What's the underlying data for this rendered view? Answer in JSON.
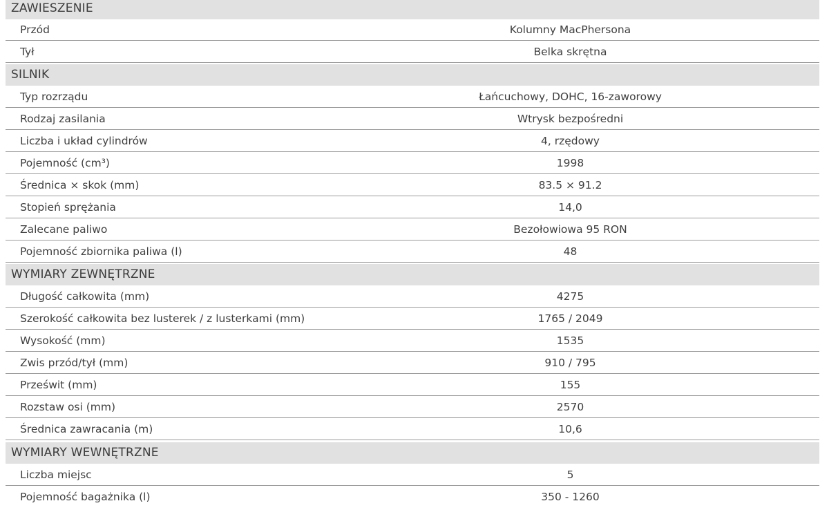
{
  "sections": [
    {
      "title": "ZAWIESZENIE",
      "rows": [
        {
          "label": "Przód",
          "value": "Kolumny MacPhersona"
        },
        {
          "label": "Tył",
          "value": "Belka skrętna"
        }
      ]
    },
    {
      "title": "SILNIK",
      "rows": [
        {
          "label": "Typ rozrządu",
          "value": "Łańcuchowy, DOHC, 16-zaworowy"
        },
        {
          "label": "Rodzaj zasilania",
          "value": "Wtrysk bezpośredni"
        },
        {
          "label": "Liczba i układ cylindrów",
          "value": "4, rzędowy"
        },
        {
          "label": "Pojemność (cm³)",
          "value": "1998"
        },
        {
          "label": "Średnica × skok (mm)",
          "value": "83.5 × 91.2"
        },
        {
          "label": "Stopień sprężania",
          "value": "14,0"
        },
        {
          "label": "Zalecane paliwo",
          "value": "Bezołowiowa 95 RON"
        },
        {
          "label": "Pojemność zbiornika paliwa (l)",
          "value": "48"
        }
      ]
    },
    {
      "title": "WYMIARY ZEWNĘTRZNE",
      "rows": [
        {
          "label": "Długość całkowita (mm)",
          "value": "4275"
        },
        {
          "label": "Szerokość całkowita bez lusterek / z lusterkami (mm)",
          "value": "1765 / 2049"
        },
        {
          "label": "Wysokość (mm)",
          "value": "1535"
        },
        {
          "label": "Zwis przód/tył (mm)",
          "value": "910 / 795"
        },
        {
          "label": "Prześwit (mm)",
          "value": "155"
        },
        {
          "label": "Rozstaw osi (mm)",
          "value": "2570"
        },
        {
          "label": "Średnica zawracania (m)",
          "value": "10,6"
        }
      ]
    },
    {
      "title": "WYMIARY WEWNĘTRZNE",
      "rows": [
        {
          "label": "Liczba miejsc",
          "value": "5"
        },
        {
          "label": "Pojemność bagażnika (l)",
          "value": "350 - 1260"
        }
      ]
    }
  ]
}
